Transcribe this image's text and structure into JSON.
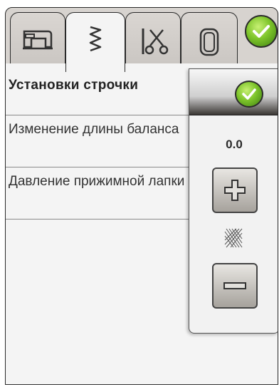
{
  "tabs": [
    {
      "name": "sewing-machine-icon"
    },
    {
      "name": "zigzag-stitch-icon",
      "active": true
    },
    {
      "name": "needle-scissors-icon"
    },
    {
      "name": "hoop-icon"
    }
  ],
  "confirm_icon": "check-icon",
  "panel": {
    "heading": "Установки строчки",
    "rows": [
      {
        "label": "Изменение длины баланса"
      },
      {
        "label": "Давление прижимной лапки"
      }
    ]
  },
  "popup": {
    "value": "0.0",
    "plus_icon": "plus-icon",
    "minus_icon": "minus-icon",
    "stitch_icon": "stitch-density-icon"
  },
  "colors": {
    "accent_green": "#7ec52b",
    "panel_bg": "#f4f4f4",
    "frame_bg": "#d7d3cf"
  }
}
